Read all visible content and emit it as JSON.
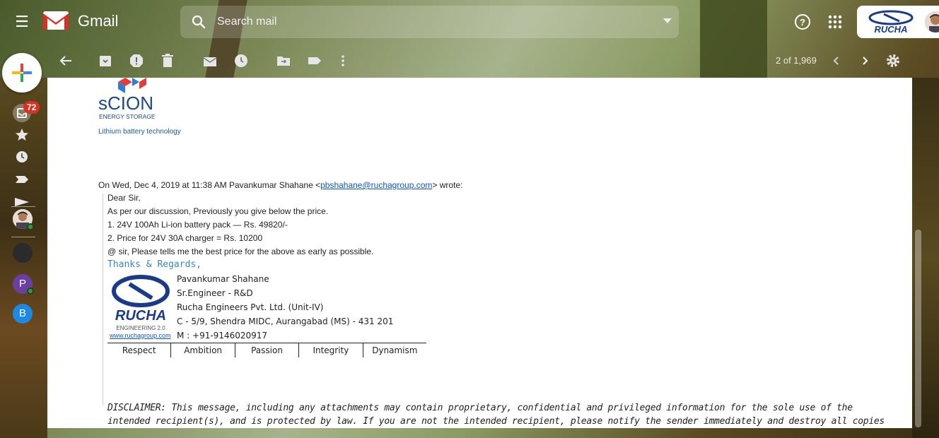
{
  "app": {
    "name": "Gmail"
  },
  "search": {
    "placeholder": "Search mail"
  },
  "account": {
    "logo_text": "RUCHA"
  },
  "rail": {
    "inbox_badge": "72",
    "avatar_p": "P",
    "avatar_b": "B"
  },
  "toolbar": {
    "pager": "2 of 1,969"
  },
  "email": {
    "company_logo_text": "sCION",
    "company_logo_sub": "ENERGY STORAGE",
    "company_tagline": "Lithium battery technology",
    "quote_intro": "On Wed, Dec 4, 2019 at 11:38 AM Pavankumar Shahane <",
    "quote_email": "pbshahane@ruchagroup.com",
    "quote_outro": "> wrote:",
    "lines": [
      "Dear Sir,",
      "As per our discussion, Previously you give below the price.",
      "1.  24V 100Ah Li-ion battery pack — Rs. 49820/-",
      "2. Price for 24V 30A charger = Rs. 10200",
      "@ sir, Please tells me the best price for the above as early as possible."
    ],
    "regards": "Thanks & Regards,",
    "signature": {
      "logo_text": "RUCHA",
      "logo_sub": "ENGINEERING 2.0",
      "website": "www.ruchagroup.com",
      "lines": [
        "Pavankumar Shahane",
        "Sr.Engineer - R&D",
        "Rucha Engineers Pvt. Ltd. (Unit-IV)",
        "C - 5/9, Shendra MIDC, Aurangabad (MS) - 431 201",
        "M : +91-9146020917"
      ],
      "values": [
        "Respect",
        "Ambition",
        "Passion",
        "Integrity",
        "Dynamism"
      ]
    },
    "disclaimer": "DISCLAIMER: This message, including any attachments may contain proprietary, confidential and privileged information for the sole use of the intended recipient(s), and is protected by law. If you are not the intended recipient, please notify the sender immediately and destroy all copies of the original message and attachments, if any."
  },
  "colors": {
    "accent": "#1155cc",
    "badge": "#d93025",
    "online": "#1ea446"
  }
}
